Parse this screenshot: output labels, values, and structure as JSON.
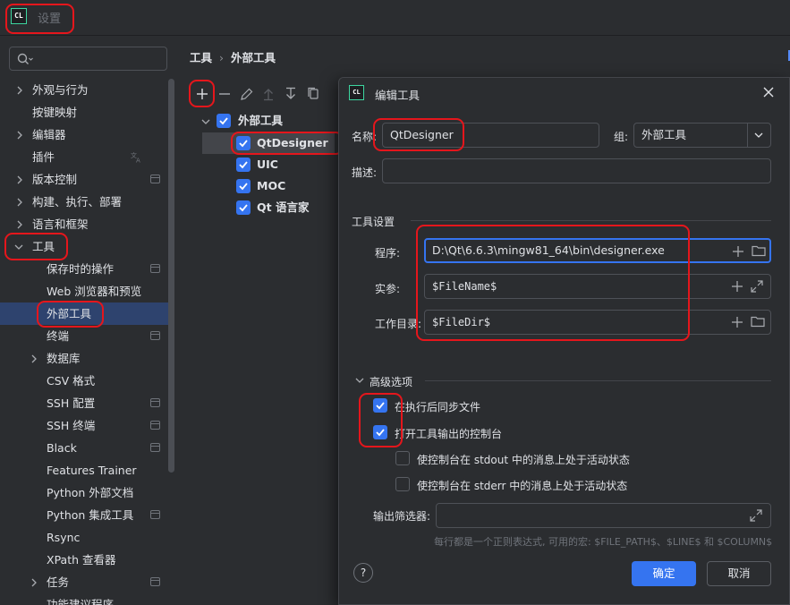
{
  "window": {
    "app_logo": "CL",
    "title": "设置"
  },
  "search": {
    "placeholder": ""
  },
  "sidebar": {
    "items": [
      {
        "label": "外观与行为",
        "expandable": true,
        "icon": "chevron-right-icon"
      },
      {
        "label": "按键映射"
      },
      {
        "label": "编辑器",
        "expandable": true,
        "icon": "chevron-right-icon"
      },
      {
        "label": "插件",
        "aux_icon": "translate-icon"
      },
      {
        "label": "版本控制",
        "expandable": true,
        "icon": "chevron-right-icon",
        "aux_icon": "project-scope-icon"
      },
      {
        "label": "构建、执行、部署",
        "expandable": true,
        "icon": "chevron-right-icon"
      },
      {
        "label": "语言和框架",
        "expandable": true,
        "icon": "chevron-right-icon"
      },
      {
        "label": "工具",
        "expandable": true,
        "expanded": true,
        "icon": "chevron-down-icon"
      },
      {
        "label": "保存时的操作",
        "aux_icon": "project-scope-icon"
      },
      {
        "label": "Web 浏览器和预览"
      },
      {
        "label": "外部工具",
        "selected": true
      },
      {
        "label": "终端",
        "aux_icon": "project-scope-icon"
      },
      {
        "label": "数据库",
        "expandable": true,
        "icon": "chevron-right-icon"
      },
      {
        "label": "CSV 格式"
      },
      {
        "label": "SSH 配置",
        "aux_icon": "project-scope-icon"
      },
      {
        "label": "SSH 终端",
        "aux_icon": "project-scope-icon"
      },
      {
        "label": "Black",
        "aux_icon": "project-scope-icon"
      },
      {
        "label": "Features Trainer"
      },
      {
        "label": "Python 外部文档"
      },
      {
        "label": "Python 集成工具",
        "aux_icon": "project-scope-icon"
      },
      {
        "label": "Rsync"
      },
      {
        "label": "XPath 查看器"
      },
      {
        "label": "任务",
        "expandable": true,
        "icon": "chevron-right-icon",
        "aux_icon": "project-scope-icon"
      },
      {
        "label": "功能建议程序"
      }
    ]
  },
  "breadcrumb": {
    "parent": "工具",
    "current": "外部工具"
  },
  "toolbar": {
    "buttons": [
      "add-icon",
      "remove-icon",
      "edit-icon",
      "move-up-icon",
      "move-down-icon",
      "copy-icon"
    ]
  },
  "tree": {
    "group": {
      "label": "外部工具",
      "checked": true
    },
    "tools": [
      {
        "label": "QtDesigner",
        "checked": true,
        "selected": true
      },
      {
        "label": "UIC",
        "checked": true
      },
      {
        "label": "MOC",
        "checked": true
      },
      {
        "label": "Qt 语言家",
        "checked": true
      }
    ]
  },
  "dialog": {
    "logo": "CL",
    "title": "编辑工具",
    "name_label": "名称:",
    "name_value": "QtDesigner",
    "group_label": "组:",
    "group_value": "外部工具",
    "desc_label": "描述:",
    "desc_value": "",
    "tool_settings_title": "工具设置",
    "program_label": "程序:",
    "program_value": "D:\\Qt\\6.6.3\\mingw81_64\\bin\\designer.exe",
    "args_label": "实参:",
    "args_value": "$FileName$",
    "workdir_label": "工作目录:",
    "workdir_value": "$FileDir$",
    "advanced_title": "高级选项",
    "sync_files_label": "在执行后同步文件",
    "sync_files_checked": true,
    "open_console_label": "打开工具输出的控制台",
    "open_console_checked": true,
    "stdout_label": "使控制台在 stdout 中的消息上处于活动状态",
    "stdout_checked": false,
    "stderr_label": "使控制台在 stderr 中的消息上处于活动状态",
    "stderr_checked": false,
    "output_filters_label": "输出筛选器:",
    "output_filters_value": "",
    "hint": "每行都是一个正则表达式, 可用的宏: $FILE_PATH$、$LINE$ 和 $COLUMN$",
    "help_label": "?",
    "ok_label": "确定",
    "cancel_label": "取消"
  },
  "colors": {
    "accent": "#3574f0",
    "selection": "#2e436e",
    "annotation": "#e5161c",
    "background": "#2b2d30"
  }
}
